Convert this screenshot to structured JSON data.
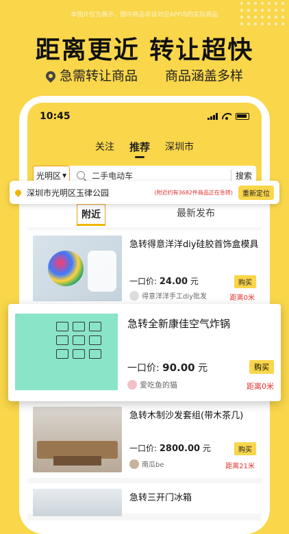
{
  "banner": {
    "disclaimer": "本图片仅为展示，图中商品非该对应APP内的实际商品",
    "headline": "距离更近 转让超快",
    "tagline_left": "急需转让商品",
    "tagline_right": "商品涵盖多样"
  },
  "status_bar": {
    "time": "10:45"
  },
  "top_tabs": [
    "关注",
    "推荐",
    "深圳市"
  ],
  "active_tab": "推荐",
  "search": {
    "district": "光明区",
    "query": "二手电动车",
    "button": "搜索"
  },
  "location": {
    "name": "深圳市光明区玉律公园",
    "note": "(附近约有3682件商品正在急转)",
    "relocate": "重新定位"
  },
  "sub_tabs": {
    "near": "附近",
    "latest": "最新发布"
  },
  "listings": [
    {
      "title": "急转得意洋洋diy硅胶首饰盒模具",
      "price_label": "一口价:",
      "price": "24.00",
      "unit": "元",
      "buy": "购买",
      "seller": "得意洋洋手工diy批发",
      "distance": "距离0米"
    },
    {
      "title": "急转全新康佳空气炸锅",
      "price_label": "一口价:",
      "price": "90.00",
      "unit": "元",
      "buy": "购买",
      "seller": "爱吃鱼的猫",
      "distance": "距离0米"
    },
    {
      "title": "急转木制沙发套组(带木茶几)",
      "price_label": "一口价:",
      "price": "2800.00",
      "unit": "元",
      "buy": "购买",
      "seller": "南瓜be",
      "distance": "距离21米"
    },
    {
      "title": "急转三开门冰箱"
    }
  ],
  "colors": {
    "brand_yellow": "#f9d64a",
    "distance_red": "#e0322d",
    "accent_orange": "#e8a020"
  }
}
